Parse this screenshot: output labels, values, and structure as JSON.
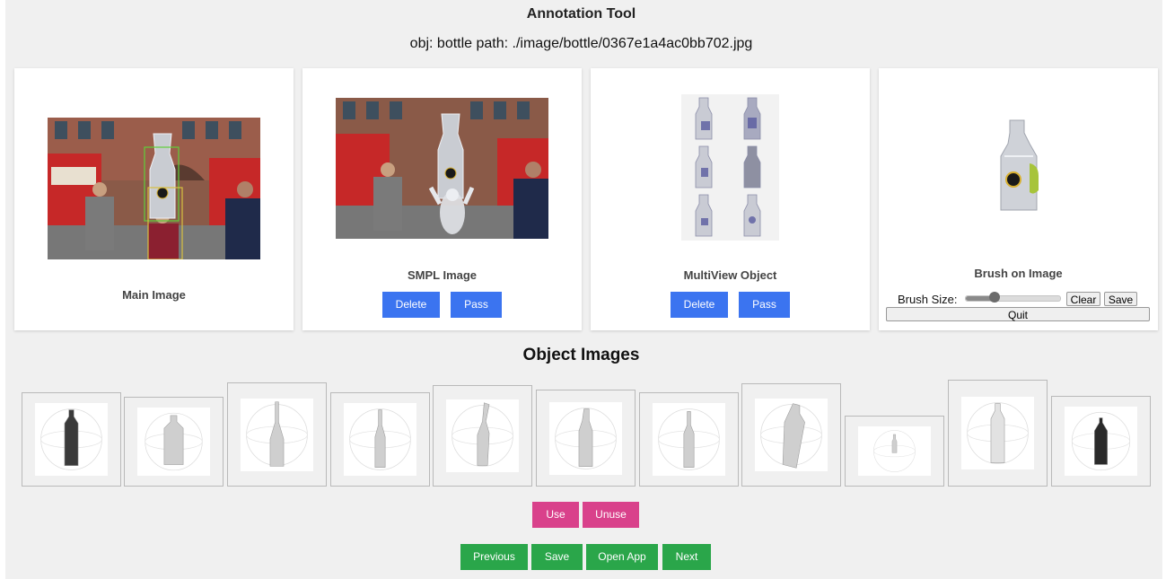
{
  "header": {
    "title": "Annotation Tool",
    "info": "obj: bottle path: ./image/bottle/0367e1a4ac0bb702.jpg"
  },
  "panels": {
    "main": {
      "caption": "Main Image"
    },
    "smpl": {
      "caption": "SMPL Image",
      "delete_label": "Delete",
      "pass_label": "Pass"
    },
    "multiview": {
      "caption": "MultiView Object",
      "delete_label": "Delete",
      "pass_label": "Pass"
    },
    "brush": {
      "caption": "Brush on Image",
      "brush_size_label": "Brush Size:",
      "brush_size_value": 0.3,
      "clear_label": "Clear",
      "save_label": "Save",
      "quit_label": "Quit"
    }
  },
  "objects": {
    "title": "Object Images",
    "count": 11
  },
  "selection": {
    "use_label": "Use",
    "unuse_label": "Unuse"
  },
  "nav": {
    "previous_label": "Previous",
    "save_label": "Save",
    "open_app_label": "Open App",
    "next_label": "Next"
  },
  "colors": {
    "blue_button": "#3b74f0",
    "pink_button": "#d9418b",
    "green_button": "#2aa64a",
    "brush_mark": "#a7c43a"
  }
}
